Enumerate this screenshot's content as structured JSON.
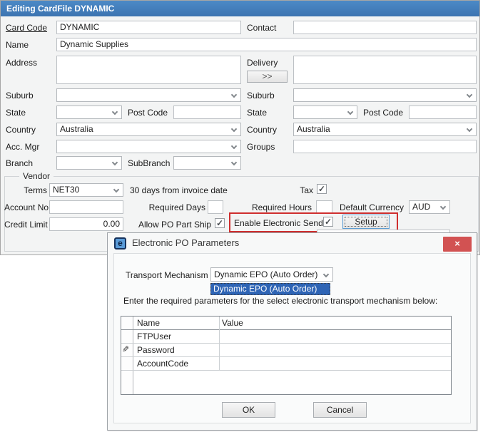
{
  "icons": {
    "check": "✓",
    "pencil": "✎",
    "close": "×",
    "app_logo": "e"
  },
  "colors": {
    "titlebar_blue": "#4380bf",
    "highlight_red": "#cf2e2e",
    "close_red": "#d25252",
    "selection_blue": "#2e64b5"
  },
  "main": {
    "title": "Editing CardFile DYNAMIC",
    "labels": {
      "card_code": "Card Code",
      "contact": "Contact",
      "name": "Name",
      "address": "Address",
      "delivery": "Delivery",
      "suburb_left": "Suburb",
      "suburb_right": "Suburb",
      "state_left": "State",
      "post_code_left": "Post Code",
      "state_right": "State",
      "post_code_right": "Post Code",
      "country_left": "Country",
      "country_right": "Country",
      "acc_mgr": "Acc. Mgr",
      "groups": "Groups",
      "branch": "Branch",
      "subbranch": "SubBranch"
    },
    "values": {
      "card_code": "DYNAMIC",
      "name": "Dynamic Supplies",
      "country_left": "Australia",
      "country_right": "Australia"
    },
    "delivery_expand_button": ">>",
    "vendor": {
      "legend": "Vendor",
      "terms_label": "Terms",
      "terms_value": "NET30",
      "terms_note": "30 days from invoice date",
      "tax_label": "Tax",
      "account_no_label": "Account No",
      "required_days_label": "Required Days",
      "required_hours_label": "Required Hours",
      "default_currency_label": "Default Currency",
      "currency_value": "AUD",
      "credit_limit_label": "Credit Limit",
      "credit_limit_value": "0.00",
      "allow_po_part_ship_label": "Allow PO Part Ship",
      "enable_electronic_send_label": "Enable Electronic Send",
      "setup_button": "Setup"
    }
  },
  "popup": {
    "title": "Electronic PO Parameters",
    "transport_label": "Transport Mechanism",
    "transport_value": "Dynamic EPO (Auto Order)",
    "dropdown_item": "Dynamic EPO (Auto Order)",
    "instruction": "Enter the required parameters for the select electronic transport mechanism below:",
    "grid": {
      "columns": [
        "Name",
        "Value"
      ],
      "rows": [
        {
          "name": "FTPUser",
          "value": "",
          "editing": false
        },
        {
          "name": "Password",
          "value": "",
          "editing": true
        },
        {
          "name": "AccountCode",
          "value": "",
          "editing": false
        }
      ]
    },
    "ok_button": "OK",
    "cancel_button": "Cancel"
  }
}
